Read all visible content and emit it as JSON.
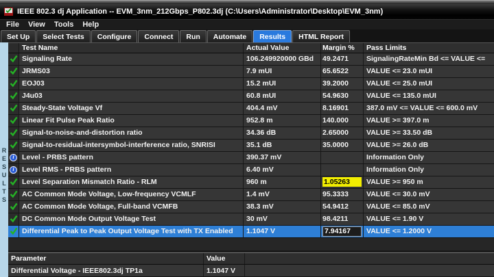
{
  "window": {
    "title": "IEEE 802.3 dj Application -- EVM_3nm_212Gbps_P802.3dj  (C:\\Users\\Administrator\\Desktop\\EVM_3nm)"
  },
  "menu": {
    "items": [
      "File",
      "View",
      "Tools",
      "Help"
    ]
  },
  "tabs": {
    "items": [
      "Set Up",
      "Select Tests",
      "Configure",
      "Connect",
      "Run",
      "Automate",
      "Results",
      "HTML Report"
    ],
    "active": "Results"
  },
  "sidebar": {
    "vertical_label": "RESULTS"
  },
  "results_table": {
    "columns": [
      "Test Name",
      "Actual Value",
      "Margin %",
      "Pass Limits"
    ],
    "rows": [
      {
        "status": "pass",
        "name": "Signaling Rate",
        "actual": "106.249920000 GBd",
        "margin": "49.2471",
        "limits": "SignalingRateMin Bd <= VALUE <=",
        "margin_style": null,
        "selected": false
      },
      {
        "status": "pass",
        "name": "JRMS03",
        "actual": "7.9 mUI",
        "margin": "65.6522",
        "limits": "VALUE <= 23.0 mUI",
        "margin_style": null,
        "selected": false
      },
      {
        "status": "pass",
        "name": "EOJ03",
        "actual": "15.2 mUI",
        "margin": "39.2000",
        "limits": "VALUE <= 25.0 mUI",
        "margin_style": null,
        "selected": false
      },
      {
        "status": "pass",
        "name": "J4u03",
        "actual": "60.8 mUI",
        "margin": "54.9630",
        "limits": "VALUE <= 135.0 mUI",
        "margin_style": null,
        "selected": false
      },
      {
        "status": "pass",
        "name": "Steady-State Voltage Vf",
        "actual": "404.4 mV",
        "margin": "8.16901",
        "limits": "387.0 mV <= VALUE <= 600.0 mV",
        "margin_style": null,
        "selected": false
      },
      {
        "status": "pass",
        "name": "Linear Fit Pulse Peak Ratio",
        "actual": "952.8 m",
        "margin": "140.000",
        "limits": "VALUE >= 397.0 m",
        "margin_style": null,
        "selected": false
      },
      {
        "status": "pass",
        "name": "Signal-to-noise-and-distortion ratio",
        "actual": "34.36 dB",
        "margin": "2.65000",
        "limits": "VALUE >= 33.50 dB",
        "margin_style": null,
        "selected": false
      },
      {
        "status": "pass",
        "name": "Signal-to-residual-intersymbol-interference ratio, SNRISI",
        "actual": "35.1 dB",
        "margin": "35.0000",
        "limits": "VALUE >= 26.0 dB",
        "margin_style": null,
        "selected": false
      },
      {
        "status": "info",
        "name": "Level - PRBS pattern",
        "actual": "390.37 mV",
        "margin": "",
        "limits": "Information Only",
        "margin_style": null,
        "selected": false
      },
      {
        "status": "info",
        "name": "Level RMS - PRBS pattern",
        "actual": "6.40 mV",
        "margin": "",
        "limits": "Information Only",
        "margin_style": null,
        "selected": false
      },
      {
        "status": "pass",
        "name": "Level Separation Mismatch Ratio - RLM",
        "actual": "960 m",
        "margin": "1.05263",
        "limits": "VALUE >= 950 m",
        "margin_style": "yellow",
        "selected": false
      },
      {
        "status": "pass",
        "name": "AC Common Mode Voltage, Low-frequency VCMLF",
        "actual": "1.4 mV",
        "margin": "95.3333",
        "limits": "VALUE <= 30.0 mV",
        "margin_style": null,
        "selected": false
      },
      {
        "status": "pass",
        "name": "AC Common Mode Voltage, Full-band VCMFB",
        "actual": "38.3 mV",
        "margin": "54.9412",
        "limits": "VALUE <= 85.0 mV",
        "margin_style": null,
        "selected": false
      },
      {
        "status": "pass",
        "name": "DC Common Mode Output Voltage Test",
        "actual": "30 mV",
        "margin": "98.4211",
        "limits": "VALUE <= 1.90 V",
        "margin_style": null,
        "selected": false
      },
      {
        "status": "pass",
        "name": "Differential Peak to Peak Output Voltage Test with TX Enabled",
        "actual": "1.1047 V",
        "margin": "7.94167",
        "limits": "VALUE <= 1.2000 V",
        "margin_style": "focus",
        "selected": true
      }
    ]
  },
  "details_table": {
    "columns": [
      "Parameter",
      "Value"
    ],
    "rows": [
      {
        "parameter": "Differential Voltage - IEEE802.3dj TP1a",
        "value": "1.1047 V"
      }
    ]
  },
  "colors": {
    "selection_blue": "#2e7fd6",
    "active_tab_blue": "#2a7ade",
    "highlight_yellow": "#f2ee00",
    "pass_green": "#25b225",
    "info_blue": "#2a5cd6",
    "strip_blue": "#b7d6e9"
  }
}
